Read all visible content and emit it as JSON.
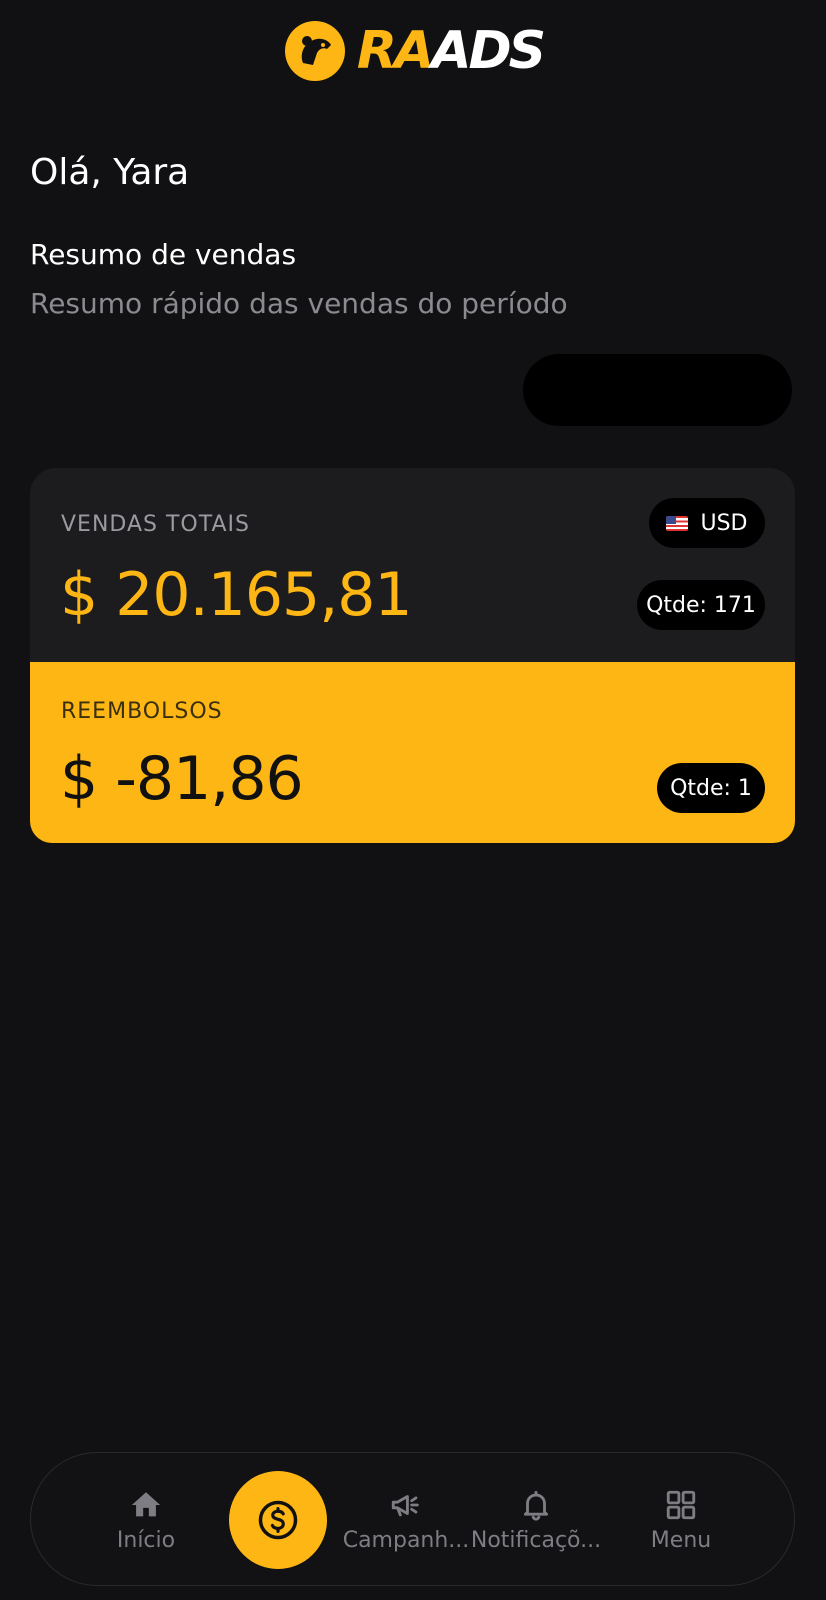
{
  "brand": {
    "name_part1": "RA",
    "name_part2": "ADS",
    "accent_color": "#FDB614"
  },
  "greeting": "Olá, Yara",
  "summary": {
    "title": "Resumo de vendas",
    "subtitle": "Resumo rápido das vendas do período"
  },
  "sales_card": {
    "label": "VENDAS TOTAIS",
    "amount": "$ 20.165,81",
    "currency": "USD",
    "currency_flag_icon": "us-flag-icon",
    "quantity": "Qtde: 171"
  },
  "refund_card": {
    "label": "REEMBOLSOS",
    "amount": "$ -81,86",
    "quantity": "Qtde: 1"
  },
  "bottom_nav": {
    "items": [
      {
        "label": "Início",
        "icon": "home-icon"
      },
      {
        "label": "",
        "icon": "dollar-icon",
        "active": true
      },
      {
        "label": "Campanh...",
        "icon": "megaphone-icon"
      },
      {
        "label": "Notificaçõ...",
        "icon": "bell-icon"
      },
      {
        "label": "Menu",
        "icon": "grid-icon"
      }
    ]
  }
}
